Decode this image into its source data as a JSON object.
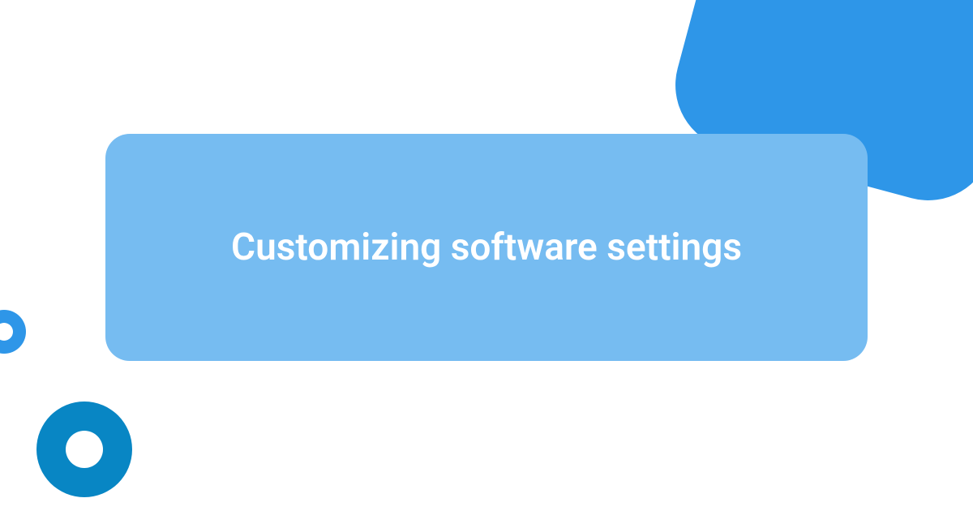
{
  "card": {
    "title": "Customizing software settings"
  }
}
